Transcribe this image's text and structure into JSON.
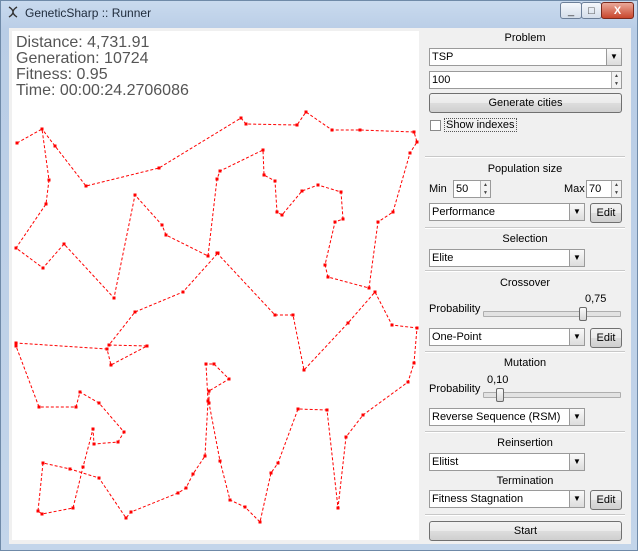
{
  "window": {
    "title": "GeneticSharp :: Runner",
    "minimize": "_",
    "maximize": "□",
    "close": "X"
  },
  "stats": {
    "distance": "Distance: 4,731.91",
    "generation": "Generation: 10724",
    "fitness": "Fitness: 0.95",
    "time": "Time: 00:00:24.2706086"
  },
  "problem": {
    "title": "Problem",
    "selected": "TSP",
    "cities": "100",
    "generate_label": "Generate cities",
    "show_indexes": "Show indexes"
  },
  "population": {
    "title": "Population size",
    "min_label": "Min",
    "min_value": "50",
    "max_label": "Max",
    "max_value": "70",
    "generation_strategy": "Performance",
    "edit_label": "Edit"
  },
  "selection": {
    "title": "Selection",
    "selected": "Elite"
  },
  "crossover": {
    "title": "Crossover",
    "probability_label": "Probability",
    "probability_value": "0,75",
    "probability": 0.75,
    "selected": "One-Point",
    "edit_label": "Edit"
  },
  "mutation": {
    "title": "Mutation",
    "probability_label": "Probability",
    "probability_value": "0,10",
    "probability": 0.1,
    "selected": "Reverse Sequence (RSM)"
  },
  "reinsertion": {
    "title": "Reinsertion",
    "selected": "Elitist"
  },
  "termination": {
    "title": "Termination",
    "selected": "Fitness Stagnation",
    "edit_label": "Edit"
  },
  "start_label": "Start",
  "colors": {
    "route": "#ff0000",
    "city": "#ff0000"
  }
}
